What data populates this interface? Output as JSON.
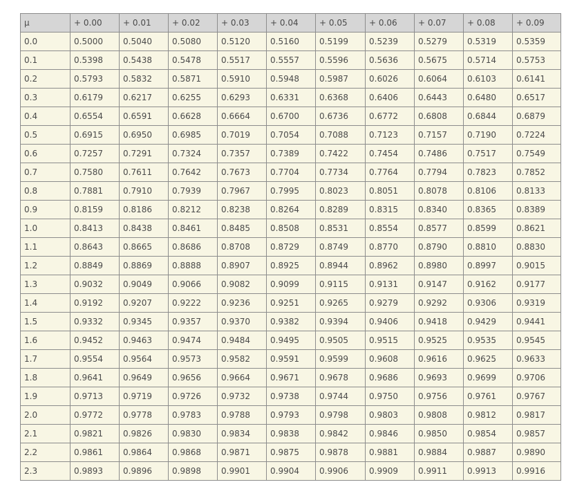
{
  "table": {
    "headers": [
      "μ",
      "+ 0.00",
      "+ 0.01",
      "+ 0.02",
      "+ 0.03",
      "+ 0.04",
      "+ 0.05",
      "+ 0.06",
      "+ 0.07",
      "+ 0.08",
      "+ 0.09"
    ],
    "rows": [
      [
        "0.0",
        "0.5000",
        "0.5040",
        "0.5080",
        "0.5120",
        "0.5160",
        "0.5199",
        "0.5239",
        "0.5279",
        "0.5319",
        "0.5359"
      ],
      [
        "0.1",
        "0.5398",
        "0.5438",
        "0.5478",
        "0.5517",
        "0.5557",
        "0.5596",
        "0.5636",
        "0.5675",
        "0.5714",
        "0.5753"
      ],
      [
        "0.2",
        "0.5793",
        "0.5832",
        "0.5871",
        "0.5910",
        "0.5948",
        "0.5987",
        "0.6026",
        "0.6064",
        "0.6103",
        "0.6141"
      ],
      [
        "0.3",
        "0.6179",
        "0.6217",
        "0.6255",
        "0.6293",
        "0.6331",
        "0.6368",
        "0.6406",
        "0.6443",
        "0.6480",
        "0.6517"
      ],
      [
        "0.4",
        "0.6554",
        "0.6591",
        "0.6628",
        "0.6664",
        "0.6700",
        "0.6736",
        "0.6772",
        "0.6808",
        "0.6844",
        "0.6879"
      ],
      [
        "0.5",
        "0.6915",
        "0.6950",
        "0.6985",
        "0.7019",
        "0.7054",
        "0.7088",
        "0.7123",
        "0.7157",
        "0.7190",
        "0.7224"
      ],
      [
        "0.6",
        "0.7257",
        "0.7291",
        "0.7324",
        "0.7357",
        "0.7389",
        "0.7422",
        "0.7454",
        "0.7486",
        "0.7517",
        "0.7549"
      ],
      [
        "0.7",
        "0.7580",
        "0.7611",
        "0.7642",
        "0.7673",
        "0.7704",
        "0.7734",
        "0.7764",
        "0.7794",
        "0.7823",
        "0.7852"
      ],
      [
        "0.8",
        "0.7881",
        "0.7910",
        "0.7939",
        "0.7967",
        "0.7995",
        "0.8023",
        "0.8051",
        "0.8078",
        "0.8106",
        "0.8133"
      ],
      [
        "0.9",
        "0.8159",
        "0.8186",
        "0.8212",
        "0.8238",
        "0.8264",
        "0.8289",
        "0.8315",
        "0.8340",
        "0.8365",
        "0.8389"
      ],
      [
        "1.0",
        "0.8413",
        "0.8438",
        "0.8461",
        "0.8485",
        "0.8508",
        "0.8531",
        "0.8554",
        "0.8577",
        "0.8599",
        "0.8621"
      ],
      [
        "1.1",
        "0.8643",
        "0.8665",
        "0.8686",
        "0.8708",
        "0.8729",
        "0.8749",
        "0.8770",
        "0.8790",
        "0.8810",
        "0.8830"
      ],
      [
        "1.2",
        "0.8849",
        "0.8869",
        "0.8888",
        "0.8907",
        "0.8925",
        "0.8944",
        "0.8962",
        "0.8980",
        "0.8997",
        "0.9015"
      ],
      [
        "1.3",
        "0.9032",
        "0.9049",
        "0.9066",
        "0.9082",
        "0.9099",
        "0.9115",
        "0.9131",
        "0.9147",
        "0.9162",
        "0.9177"
      ],
      [
        "1.4",
        "0.9192",
        "0.9207",
        "0.9222",
        "0.9236",
        "0.9251",
        "0.9265",
        "0.9279",
        "0.9292",
        "0.9306",
        "0.9319"
      ],
      [
        "1.5",
        "0.9332",
        "0.9345",
        "0.9357",
        "0.9370",
        "0.9382",
        "0.9394",
        "0.9406",
        "0.9418",
        "0.9429",
        "0.9441"
      ],
      [
        "1.6",
        "0.9452",
        "0.9463",
        "0.9474",
        "0.9484",
        "0.9495",
        "0.9505",
        "0.9515",
        "0.9525",
        "0.9535",
        "0.9545"
      ],
      [
        "1.7",
        "0.9554",
        "0.9564",
        "0.9573",
        "0.9582",
        "0.9591",
        "0.9599",
        "0.9608",
        "0.9616",
        "0.9625",
        "0.9633"
      ],
      [
        "1.8",
        "0.9641",
        "0.9649",
        "0.9656",
        "0.9664",
        "0.9671",
        "0.9678",
        "0.9686",
        "0.9693",
        "0.9699",
        "0.9706"
      ],
      [
        "1.9",
        "0.9713",
        "0.9719",
        "0.9726",
        "0.9732",
        "0.9738",
        "0.9744",
        "0.9750",
        "0.9756",
        "0.9761",
        "0.9767"
      ],
      [
        "2.0",
        "0.9772",
        "0.9778",
        "0.9783",
        "0.9788",
        "0.9793",
        "0.9798",
        "0.9803",
        "0.9808",
        "0.9812",
        "0.9817"
      ],
      [
        "2.1",
        "0.9821",
        "0.9826",
        "0.9830",
        "0.9834",
        "0.9838",
        "0.9842",
        "0.9846",
        "0.9850",
        "0.9854",
        "0.9857"
      ],
      [
        "2.2",
        "0.9861",
        "0.9864",
        "0.9868",
        "0.9871",
        "0.9875",
        "0.9878",
        "0.9881",
        "0.9884",
        "0.9887",
        "0.9890"
      ],
      [
        "2.3",
        "0.9893",
        "0.9896",
        "0.9898",
        "0.9901",
        "0.9904",
        "0.9906",
        "0.9909",
        "0.9911",
        "0.9913",
        "0.9916"
      ]
    ]
  },
  "colors": {
    "header_bg": "#d6d6d6",
    "cell_bg": "#f8f6e4",
    "border": "#8c8c8c",
    "text": "#4a4a4a"
  }
}
